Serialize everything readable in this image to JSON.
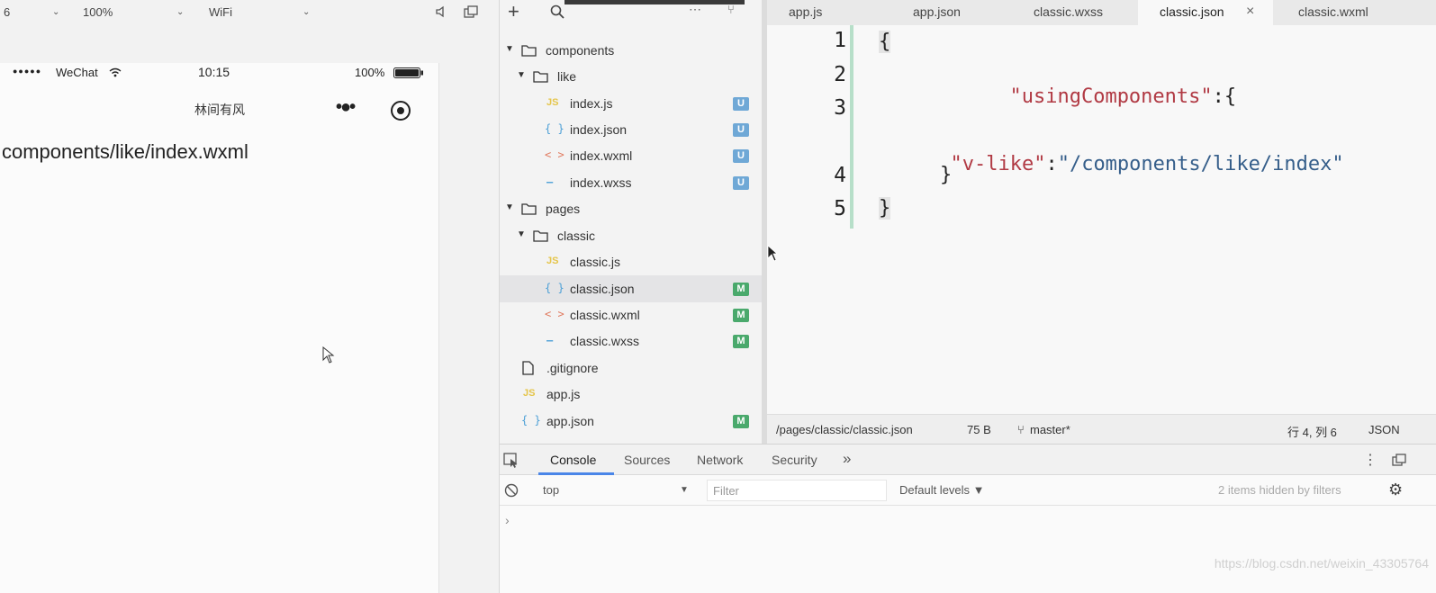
{
  "simulator": {
    "device": "6",
    "zoom": "100%",
    "network": "WiFi",
    "status": {
      "carrier": "WeChat",
      "time": "10:15",
      "battery": "100%"
    },
    "nav_title": "林间有风",
    "page_text": "components/like/index.wxml"
  },
  "explorer": {
    "items": [
      {
        "type": "folder",
        "label": "components"
      },
      {
        "type": "folder",
        "label": "like"
      },
      {
        "type": "js",
        "icon": "JS",
        "label": "index.js",
        "badge": "U"
      },
      {
        "type": "json",
        "icon": "{ }",
        "label": "index.json",
        "badge": "U"
      },
      {
        "type": "wxml",
        "icon": "< >",
        "label": "index.wxml",
        "badge": "U"
      },
      {
        "type": "wxss",
        "icon": "—",
        "label": "index.wxss",
        "badge": "U"
      },
      {
        "type": "folder",
        "label": "pages"
      },
      {
        "type": "folder",
        "label": "classic"
      },
      {
        "type": "js",
        "icon": "JS",
        "label": "classic.js",
        "badge": ""
      },
      {
        "type": "json",
        "icon": "{ }",
        "label": "classic.json",
        "badge": "M"
      },
      {
        "type": "wxml",
        "icon": "< >",
        "label": "classic.wxml",
        "badge": "M"
      },
      {
        "type": "wxss",
        "icon": "—",
        "label": "classic.wxss",
        "badge": "M"
      },
      {
        "type": "file",
        "label": ".gitignore",
        "badge": ""
      },
      {
        "type": "js",
        "icon": "JS",
        "label": "app.js",
        "badge": ""
      },
      {
        "type": "json",
        "icon": "{ }",
        "label": "app.json",
        "badge": "M"
      }
    ]
  },
  "tabs": [
    {
      "label": "app.js"
    },
    {
      "label": "app.json"
    },
    {
      "label": "classic.wxss"
    },
    {
      "label": "classic.json",
      "close": "×"
    },
    {
      "label": "classic.wxml"
    }
  ],
  "editor": {
    "line_numbers": [
      "1",
      "2",
      "3",
      "4",
      "5"
    ],
    "open_brace": "{",
    "key_using": "\"usingComponents\"",
    "colon_brace": ":{",
    "key_vlike": "\"v-like\"",
    "colon": ":",
    "value_path": "\"/components/like/index\"",
    "inner_close": "}",
    "close_brace": "}"
  },
  "statusbar": {
    "path": "/pages/classic/classic.json",
    "size": "75 B",
    "branch": "master*",
    "position": "行 4, 列 6",
    "language": "JSON"
  },
  "devtools": {
    "tabs": [
      "Console",
      "Sources",
      "Network",
      "Security"
    ],
    "more": "»",
    "context": "top",
    "filter_placeholder": "Filter",
    "levels": "Default levels ▼",
    "hidden": "2 items hidden by filters",
    "prompt": "›",
    "watermark": "https://blog.csdn.net/weixin_43305764"
  },
  "colors": {
    "accent": "#4a86e8",
    "badge_u": "#6fa8d6",
    "badge_m": "#4aa96c"
  }
}
